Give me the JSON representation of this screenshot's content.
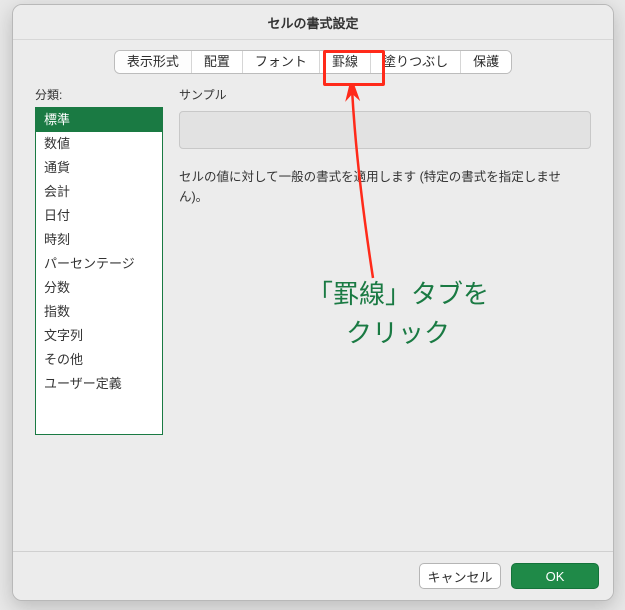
{
  "dialog": {
    "title": "セルの書式設定"
  },
  "tabs": {
    "t0": "表示形式",
    "t1": "配置",
    "t2": "フォント",
    "t3": "罫線",
    "t4": "塗りつぶし",
    "t5": "保護"
  },
  "left": {
    "label": "分類:",
    "items": {
      "c0": "標準",
      "c1": "数値",
      "c2": "通貨",
      "c3": "会計",
      "c4": "日付",
      "c5": "時刻",
      "c6": "パーセンテージ",
      "c7": "分数",
      "c8": "指数",
      "c9": "文字列",
      "c10": "その他",
      "c11": "ユーザー定義"
    }
  },
  "right": {
    "sample_label": "サンプル",
    "description": "セルの値に対して一般の書式を適用します (特定の書式を指定しません)。"
  },
  "footer": {
    "cancel": "キャンセル",
    "ok": "OK"
  },
  "annotation": {
    "line1": "「罫線」タブを",
    "line2": "クリック"
  }
}
